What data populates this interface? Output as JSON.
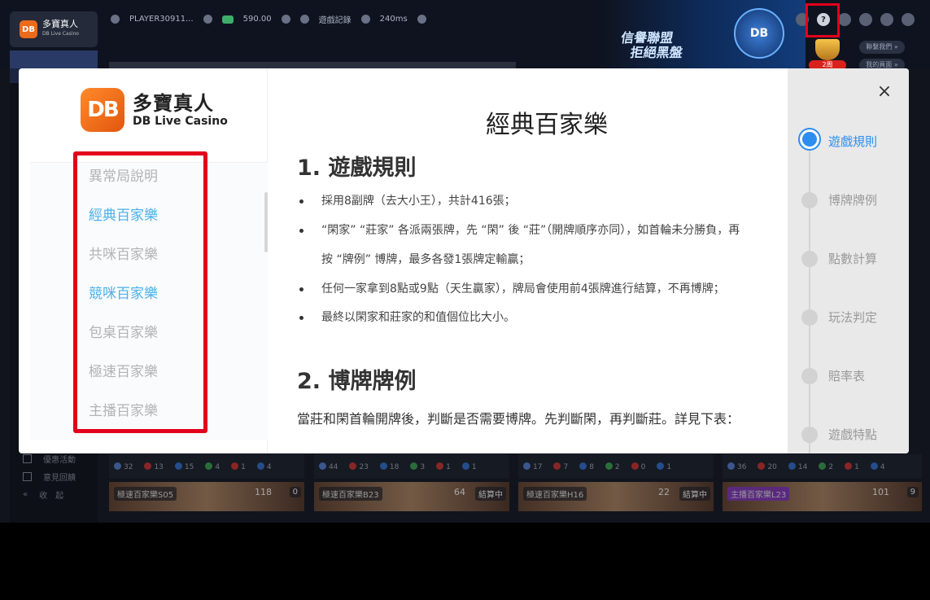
{
  "topbar": {
    "brand_title": "多寶真人",
    "brand_sub": "DB Live Casino",
    "player": "PLAYER30911...",
    "balance": "590.00",
    "records": "遊戲記錄",
    "ping": "240ms",
    "banner_line1": "信譽聯盟",
    "banner_line2": "拒絕黑盤",
    "shield_text": "DB",
    "trophy_label": "2周",
    "pill1": "聯繫我們 »",
    "pill2": "我的頁面 »",
    "help_icon": "?"
  },
  "leftnav": {
    "items": [
      "優惠活動",
      "意見回饋",
      "收　起"
    ]
  },
  "modal": {
    "brand_title": "多寶真人",
    "brand_sub": "DB Live Casino",
    "logo_mark": "DB",
    "close": "×",
    "side_items": [
      {
        "label": "異常局說明",
        "active": false
      },
      {
        "label": "經典百家樂",
        "active": true
      },
      {
        "label": "共咪百家樂",
        "active": false
      },
      {
        "label": "競咪百家樂",
        "active": true
      },
      {
        "label": "包桌百家樂",
        "active": false
      },
      {
        "label": "極速百家樂",
        "active": false
      },
      {
        "label": "主播百家樂",
        "active": false
      }
    ],
    "content": {
      "title": "經典百家樂",
      "section1": "1. 遊戲規則",
      "rules": [
        "採用8副牌（去大小王），共計416張；",
        "“閑家” “莊家” 各派兩張牌，先 “閑” 後 “莊”（開牌順序亦同），如首輪未分勝負，再",
        "按 “牌例” 博牌，最多各發1張牌定輸贏；",
        "任何一家拿到8點或9點（天生贏家），牌局會使用前4張牌進行結算，不再博牌；",
        "最終以閑家和莊家的和值個位比大小。"
      ],
      "section2": "2. 博牌牌例",
      "paragraph": "當莊和閑首輪開牌後，判斷是否需要博牌。先判斷閑，再判斷莊。詳見下表："
    },
    "toc": [
      {
        "label": "遊戲規則",
        "active": true
      },
      {
        "label": "博牌牌例",
        "active": false
      },
      {
        "label": "點數計算",
        "active": false
      },
      {
        "label": "玩法判定",
        "active": false
      },
      {
        "label": "賠率表",
        "active": false
      },
      {
        "label": "遊戲特點",
        "active": false
      }
    ]
  },
  "stats_rows": [
    [
      "32",
      "13",
      "15",
      "4",
      "1",
      "4"
    ],
    [
      "44",
      "23",
      "18",
      "3",
      "1",
      "1"
    ],
    [
      "17",
      "7",
      "8",
      "2",
      "0",
      "1"
    ],
    [
      "36",
      "20",
      "14",
      "2",
      "1",
      "4"
    ]
  ],
  "tiles": [
    {
      "name": "極速百家樂S05",
      "count": "118",
      "state": "0"
    },
    {
      "name": "極速百家樂B23",
      "count": "64",
      "state": "結算中"
    },
    {
      "name": "極速百家樂H16",
      "count": "22",
      "state": "結算中"
    },
    {
      "name": "主播百家樂L23",
      "count": "101",
      "state": "9"
    }
  ],
  "colors": {
    "accent_blue": "#2d8ef0",
    "side_blue": "#4ab0ec",
    "highlight_red": "#e3001b",
    "brand_orange": "#ec6a1b"
  }
}
